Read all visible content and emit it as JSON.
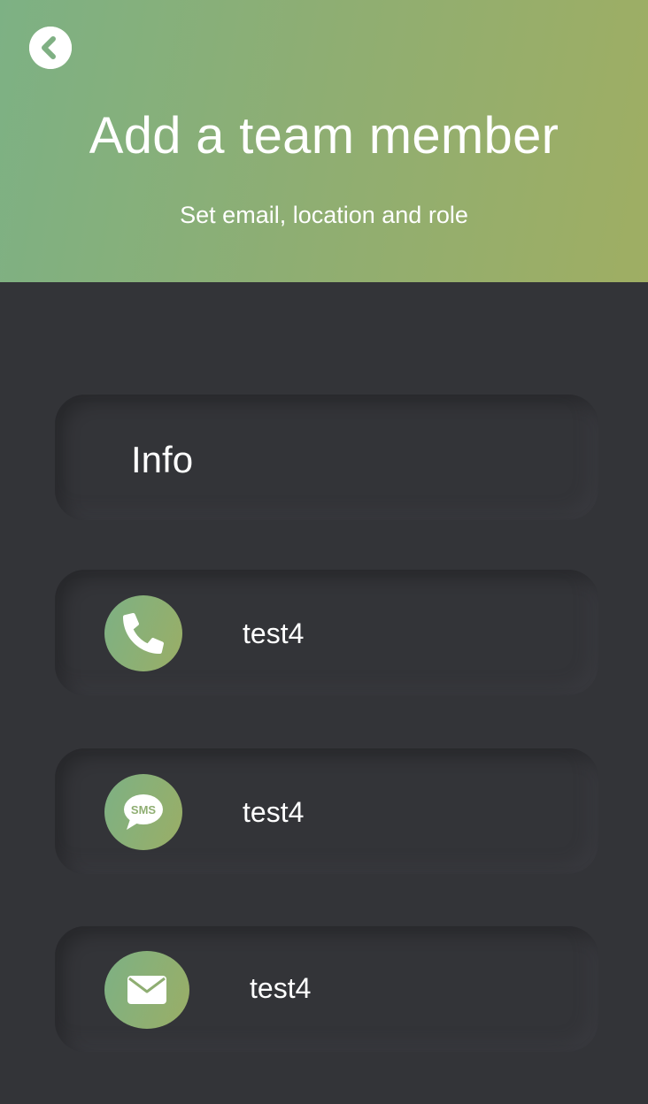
{
  "header": {
    "title": "Add a team member",
    "subtitle": "Set email, location and role",
    "gradient_start": "#7db184",
    "gradient_end": "#9fae63"
  },
  "back_button": {
    "icon": "chevron-left-icon"
  },
  "info_card": {
    "label": "Info"
  },
  "contacts": {
    "phone": {
      "icon": "phone-icon",
      "value": "test4"
    },
    "sms": {
      "icon": "sms-icon",
      "value": "test4"
    },
    "email": {
      "icon": "envelope-icon",
      "value": "test4"
    }
  },
  "colors": {
    "background": "#333438",
    "accent": "#8fae72",
    "text": "#ffffff"
  }
}
